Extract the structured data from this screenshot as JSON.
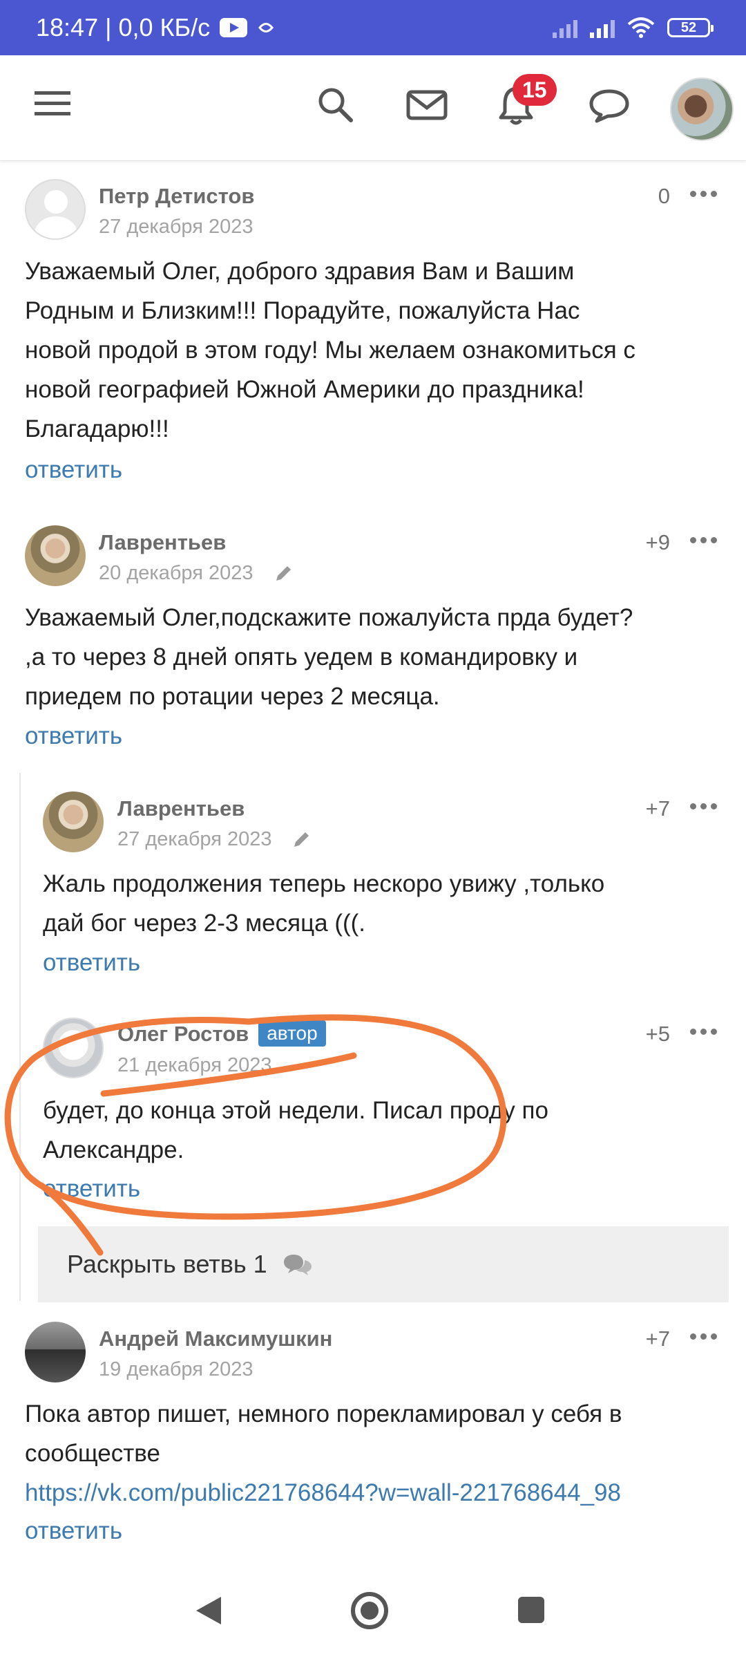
{
  "status_bar": {
    "time": "18:47 | 0,0 КБ/с",
    "battery": "52"
  },
  "app_header": {
    "icons": [
      "menu-icon",
      "search-icon",
      "mail-icon",
      "bell-icon",
      "chat-icon"
    ],
    "notification_count": "15"
  },
  "comments": [
    {
      "author": "Петр Детистов",
      "date": "27 декабря 2023",
      "score": "0",
      "lines": [
        "Уважаемый Олег, доброго здравия Вам и Вашим",
        "Родным и Близким!!! Порадуйте, пожалуйста Нас",
        "новой продой в этом году! Мы желаем ознакомиться с",
        "новой географией Южной Америки до праздника!",
        "Благадарю!!!"
      ],
      "reply": "ответить"
    },
    {
      "author": "Лаврентьев",
      "date": "20 декабря 2023",
      "score": "+9",
      "lines": [
        "Уважаемый Олег,подскажите пожалуйста прда будет?",
        ",а то через 8 дней опять уедем в командировку и",
        "приедем по ротации через 2 месяца."
      ],
      "reply": "ответить"
    },
    {
      "author": "Лаврентьев",
      "date": "27 декабря 2023",
      "score": "+7",
      "lines": [
        "Жаль продолжения теперь нескоро увижу ,только",
        "дай бог через 2-3 месяца (((."
      ],
      "reply": "ответить"
    },
    {
      "author": "Олег Ростов",
      "author_badge": "автор",
      "date": "21 декабря 2023",
      "score": "+5",
      "lines": [
        "будет, до конца этой недели. Писал проду по",
        "Александре."
      ],
      "reply": "ответить"
    },
    {
      "author": "Андрей Максимушкин",
      "date": "19 декабря 2023",
      "score": "+7",
      "lines": [
        "Пока автор пишет, немного порекламировал у себя в",
        "сообществе"
      ],
      "link": "https://vk.com/public221768644?w=wall-221768644_98",
      "reply": "ответить"
    }
  ],
  "expand_branch": "Раскрыть ветвь 1",
  "annotation_color": "#f07a3c",
  "nav_icons": [
    "back-icon",
    "home-icon",
    "recents-icon"
  ]
}
